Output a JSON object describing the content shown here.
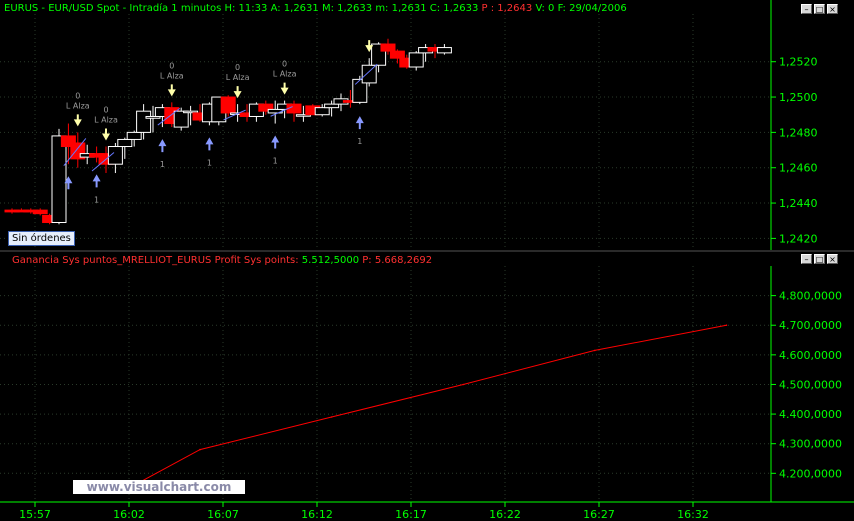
{
  "upper_header": {
    "symbol": "EURUS - EUR/USD Spot - Intradía 1 minutos",
    "h": "H: 11:33",
    "a": "A: 1,2631",
    "m": "M: 1,2633",
    "mm": "m: 1,2631",
    "c": "C: 1,2633",
    "p": "P : 1,2643",
    "v": "V: 0",
    "f": "F: 29/04/2006"
  },
  "lower_header": {
    "name": "Ganancia Sys puntos_MRELLIOT_EURUS",
    "label": "Profit Sys points:",
    "value": "5.512,5000",
    "p": "P: 5.668,2692"
  },
  "badge": "Sin órdenes",
  "watermark": "www.visualchart.com",
  "window_buttons": [
    "–",
    "□",
    "×"
  ],
  "colors": {
    "background": "#000000",
    "up_candle": "#ffffff",
    "down_candle": "#ff0000",
    "axis": "#00ff00",
    "grid": "#2a3a2a",
    "profit_line": "#ff0000",
    "buy_arrow": "#8899ff",
    "sell_arrow": "#ffffaa"
  },
  "chart_data": [
    {
      "type": "candlestick",
      "title": "EURUS - EUR/USD Spot - Intradía 1 minutos",
      "ylim": [
        1.2414,
        1.2547
      ],
      "y_ticks": [
        1.242,
        1.244,
        1.246,
        1.248,
        1.25,
        1.252
      ],
      "y_tick_labels": [
        "1,2420",
        "1,2440",
        "1,2460",
        "1,2480",
        "1,2500",
        "1,2520"
      ],
      "grid": true,
      "candles": [
        {
          "o": 1.2436,
          "h": 1.2437,
          "l": 1.2434,
          "c": 1.2435
        },
        {
          "o": 1.2436,
          "h": 1.2437,
          "l": 1.2435,
          "c": 1.2435
        },
        {
          "o": 1.2436,
          "h": 1.2437,
          "l": 1.2434,
          "c": 1.2435
        },
        {
          "o": 1.2436,
          "h": 1.2437,
          "l": 1.2433,
          "c": 1.2434
        },
        {
          "o": 1.2433,
          "h": 1.2434,
          "l": 1.2428,
          "c": 1.2429
        },
        {
          "o": 1.2429,
          "h": 1.2482,
          "l": 1.2428,
          "c": 1.2478
        },
        {
          "o": 1.2478,
          "h": 1.2485,
          "l": 1.2462,
          "c": 1.2472
        },
        {
          "o": 1.2474,
          "h": 1.248,
          "l": 1.246,
          "c": 1.2465
        },
        {
          "o": 1.2466,
          "h": 1.2473,
          "l": 1.2462,
          "c": 1.2468
        },
        {
          "o": 1.2468,
          "h": 1.2472,
          "l": 1.2463,
          "c": 1.2466
        },
        {
          "o": 1.2468,
          "h": 1.2472,
          "l": 1.2457,
          "c": 1.2462
        },
        {
          "o": 1.2462,
          "h": 1.2474,
          "l": 1.2457,
          "c": 1.2472
        },
        {
          "o": 1.2472,
          "h": 1.2477,
          "l": 1.2465,
          "c": 1.2476
        },
        {
          "o": 1.2476,
          "h": 1.2481,
          "l": 1.2472,
          "c": 1.248
        },
        {
          "o": 1.248,
          "h": 1.2496,
          "l": 1.2476,
          "c": 1.2492
        },
        {
          "o": 1.2488,
          "h": 1.2495,
          "l": 1.248,
          "c": 1.2489
        },
        {
          "o": 1.2489,
          "h": 1.2496,
          "l": 1.2483,
          "c": 1.2494
        },
        {
          "o": 1.2494,
          "h": 1.2497,
          "l": 1.2483,
          "c": 1.2485
        },
        {
          "o": 1.2483,
          "h": 1.2494,
          "l": 1.2481,
          "c": 1.2492
        },
        {
          "o": 1.2492,
          "h": 1.2495,
          "l": 1.2484,
          "c": 1.2492
        },
        {
          "o": 1.2491,
          "h": 1.2496,
          "l": 1.2486,
          "c": 1.2487
        },
        {
          "o": 1.2486,
          "h": 1.2497,
          "l": 1.2484,
          "c": 1.2496
        },
        {
          "o": 1.2486,
          "h": 1.25,
          "l": 1.2484,
          "c": 1.25
        },
        {
          "o": 1.25,
          "h": 1.2501,
          "l": 1.2489,
          "c": 1.2491
        },
        {
          "o": 1.2491,
          "h": 1.2496,
          "l": 1.2486,
          "c": 1.2491
        },
        {
          "o": 1.2491,
          "h": 1.2496,
          "l": 1.2486,
          "c": 1.2489
        },
        {
          "o": 1.2489,
          "h": 1.2497,
          "l": 1.2486,
          "c": 1.2496
        },
        {
          "o": 1.2496,
          "h": 1.2498,
          "l": 1.249,
          "c": 1.2492
        },
        {
          "o": 1.2491,
          "h": 1.2498,
          "l": 1.2485,
          "c": 1.2493
        },
        {
          "o": 1.2493,
          "h": 1.2498,
          "l": 1.2488,
          "c": 1.2496
        },
        {
          "o": 1.2496,
          "h": 1.2498,
          "l": 1.2486,
          "c": 1.2491
        },
        {
          "o": 1.249,
          "h": 1.2495,
          "l": 1.2486,
          "c": 1.249
        },
        {
          "o": 1.2495,
          "h": 1.2496,
          "l": 1.249,
          "c": 1.249
        },
        {
          "o": 1.249,
          "h": 1.2496,
          "l": 1.2489,
          "c": 1.2494
        },
        {
          "o": 1.2494,
          "h": 1.2498,
          "l": 1.2489,
          "c": 1.2496
        },
        {
          "o": 1.2496,
          "h": 1.2502,
          "l": 1.2492,
          "c": 1.2499
        },
        {
          "o": 1.2498,
          "h": 1.2504,
          "l": 1.2494,
          "c": 1.2497
        },
        {
          "o": 1.2497,
          "h": 1.2512,
          "l": 1.2496,
          "c": 1.251
        },
        {
          "o": 1.2508,
          "h": 1.2522,
          "l": 1.2506,
          "c": 1.2518
        },
        {
          "o": 1.2518,
          "h": 1.2531,
          "l": 1.2514,
          "c": 1.253
        },
        {
          "o": 1.253,
          "h": 1.2533,
          "l": 1.2524,
          "c": 1.2526
        },
        {
          "o": 1.2526,
          "h": 1.2527,
          "l": 1.2519,
          "c": 1.2522
        },
        {
          "o": 1.2522,
          "h": 1.2524,
          "l": 1.2516,
          "c": 1.2517
        },
        {
          "o": 1.2517,
          "h": 1.2526,
          "l": 1.2515,
          "c": 1.2525
        },
        {
          "o": 1.2525,
          "h": 1.253,
          "l": 1.252,
          "c": 1.2528
        },
        {
          "o": 1.2528,
          "h": 1.253,
          "l": 1.2522,
          "c": 1.2526
        },
        {
          "o": 1.2525,
          "h": 1.253,
          "l": 1.2524,
          "c": 1.2528
        }
      ]
    },
    {
      "type": "line",
      "series": [
        {
          "x": [
            13,
            20,
            34,
            48,
            62,
            76
          ],
          "values": [
            4160000,
            4280000,
            4390000,
            4500000,
            4615000,
            4700000
          ]
        }
      ],
      "ylim": [
        4120000,
        4900000
      ],
      "y_ticks": [
        4200000,
        4300000,
        4400000,
        4500000,
        4600000,
        4700000,
        4800000
      ],
      "y_tick_labels": [
        "4.200,0000",
        "4.300,0000",
        "4.400,0000",
        "4.500,0000",
        "4.600,0000",
        "4.700,0000",
        "4.800,0000"
      ],
      "grid": true
    }
  ],
  "x_axis": {
    "labels": [
      "15:57",
      "16:02",
      "16:07",
      "16:12",
      "16:17",
      "16:22",
      "16:27",
      "16:32"
    ],
    "label_candle_index": [
      0,
      5,
      10,
      15,
      20,
      25,
      30,
      35
    ]
  },
  "signals": [
    {
      "type": "buy",
      "candle": 6,
      "labels": []
    },
    {
      "type": "sell",
      "candle": 7,
      "labels": [
        "0",
        "L Alza"
      ]
    },
    {
      "type": "buy",
      "candle": 9,
      "labels": [
        "1"
      ]
    },
    {
      "type": "sell",
      "candle": 10,
      "labels": [
        "0",
        "L Alza"
      ]
    },
    {
      "type": "buy",
      "candle": 16,
      "labels": [
        "1"
      ]
    },
    {
      "type": "sell",
      "candle": 17,
      "labels": [
        "0",
        "L Alza"
      ]
    },
    {
      "type": "buy",
      "candle": 21,
      "labels": [
        "1"
      ]
    },
    {
      "type": "sell",
      "candle": 24,
      "labels": [
        "0",
        "L Alza"
      ]
    },
    {
      "type": "buy",
      "candle": 28,
      "labels": [
        "1"
      ]
    },
    {
      "type": "sell",
      "candle": 29,
      "labels": [
        "0",
        "L Alza"
      ]
    },
    {
      "type": "buy",
      "candle": 37,
      "labels": [
        "1"
      ]
    },
    {
      "type": "sell",
      "candle": 38,
      "labels": []
    }
  ]
}
